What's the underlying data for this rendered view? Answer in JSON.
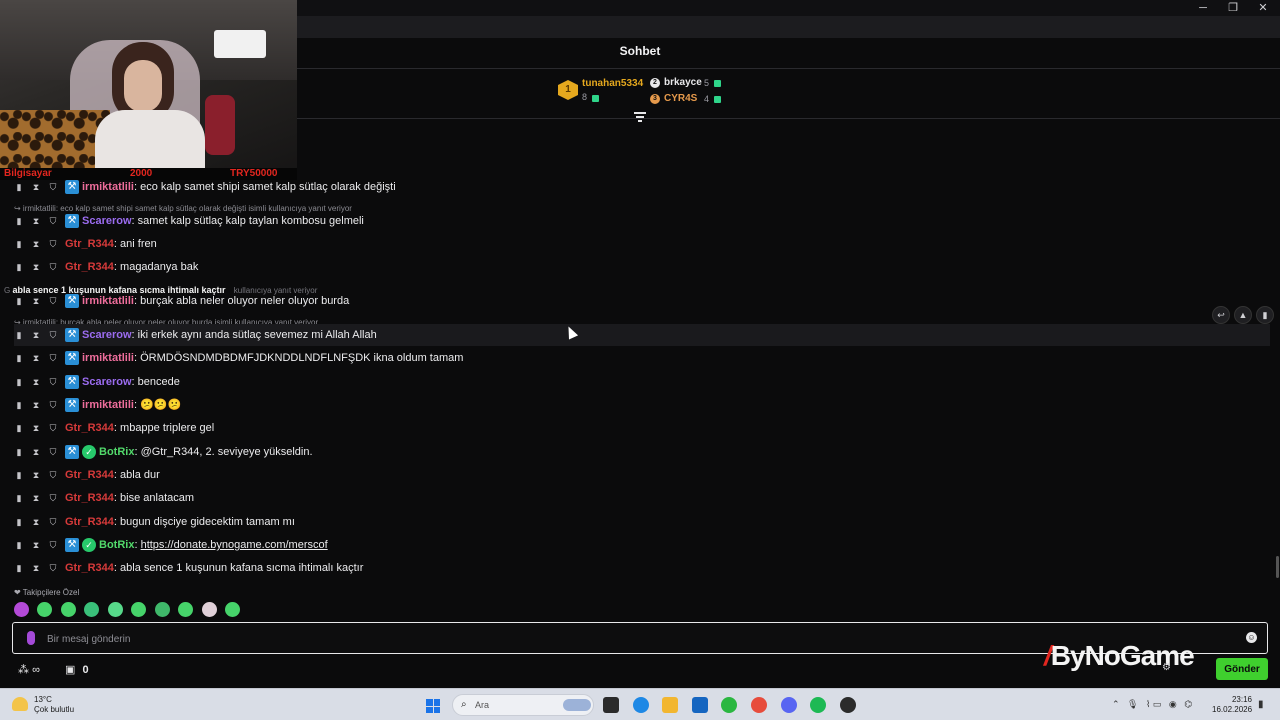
{
  "window": {
    "minimize": "─",
    "maximize": "❐",
    "close": "✕"
  },
  "webcam": {
    "ticker_left": "Bilgisayar",
    "ticker_mid": "2000",
    "ticker_right": "TRY50000"
  },
  "chat": {
    "title": "Sohbet",
    "leaderboard": [
      {
        "rank": "1",
        "name": "tunahan5334",
        "count": "8",
        "color": "#e5a81e"
      },
      {
        "rank": "2",
        "name": "brkayce",
        "count": "5",
        "color": "#e8e8ea"
      },
      {
        "rank": "3",
        "name": "CYR4S",
        "count": "4",
        "color": "#e69a4c"
      }
    ],
    "ghost_overlay": "abla sence 1 kuşunun kafana sıcma ihtimalı kaçtır",
    "ghost_prefix": "G",
    "ghost_suffix": "kullanıcıya yanıt veriyor",
    "messages": [
      {
        "user": "irmiktatlili",
        "text": ": eco kalp samet shipi samet kalp sütlaç olarak değişti"
      },
      {
        "reply": "irmiktatlili: eco kalp samet shipi samet kalp sütlaç olarak değişti isimli kullanıcıya yanıt veriyor"
      },
      {
        "user": "Scarerow",
        "text": ": samet kalp sütlaç kalp taylan kombosu gelmeli"
      },
      {
        "user": "Gtr_R344",
        "text": ": ani fren"
      },
      {
        "user": "Gtr_R344",
        "text": ": magadanya bak"
      },
      {
        "user": "irmiktatlili",
        "text": ": burçak abla neler oluyor neler oluyor burda"
      },
      {
        "reply": "irmiktatlili: burçak abla neler oluyor neler oluyor burda isimli kullanıcıya yanıt veriyor"
      },
      {
        "user": "Scarerow",
        "text": ": iki erkek aynı anda sütlaç sevemez mi Allah Allah"
      },
      {
        "user": "irmiktatlili",
        "text": ": ÖRMDÖSNDMDBDMFJDKNDDLNDFLNFŞDK ikna oldum tamam"
      },
      {
        "user": "Scarerow",
        "text": ": bencede"
      },
      {
        "user": "irmiktatlili",
        "text": ": 😕😕😕"
      },
      {
        "user": "Gtr_R344",
        "text": ": mbappe triplere gel"
      },
      {
        "user": "BotRix",
        "text": ": @Gtr_R344, 2. seviyeye yükseldin."
      },
      {
        "user": "Gtr_R344",
        "text": ": abla dur"
      },
      {
        "user": "Gtr_R344",
        "text": ": bise anlatacam"
      },
      {
        "user": "Gtr_R344",
        "text": ": bugun dişciye gidecektim tamam mı"
      },
      {
        "user": "BotRix",
        "text": ": ",
        "link": "https://donate.bynogame.com/merscof"
      },
      {
        "user": "Gtr_R344",
        "text": ": abla sence 1 kuşunun kafana sıcma ihtimalı kaçtır"
      }
    ],
    "row_actions": [
      "↩",
      "📌",
      "🗑"
    ]
  },
  "composer": {
    "followers_label": "❤ Takipçilere Özel",
    "placeholder": "Bir mesaj gönderin",
    "viewer_count": "0",
    "send_label": "Gönder",
    "brand": "ByNoGame",
    "brand_mark": "/"
  },
  "taskbar": {
    "weather_temp": "13°C",
    "weather_desc": "Çok bulutlu",
    "search_label": "Ara",
    "time": "23:16",
    "date": "16.02.2026"
  }
}
